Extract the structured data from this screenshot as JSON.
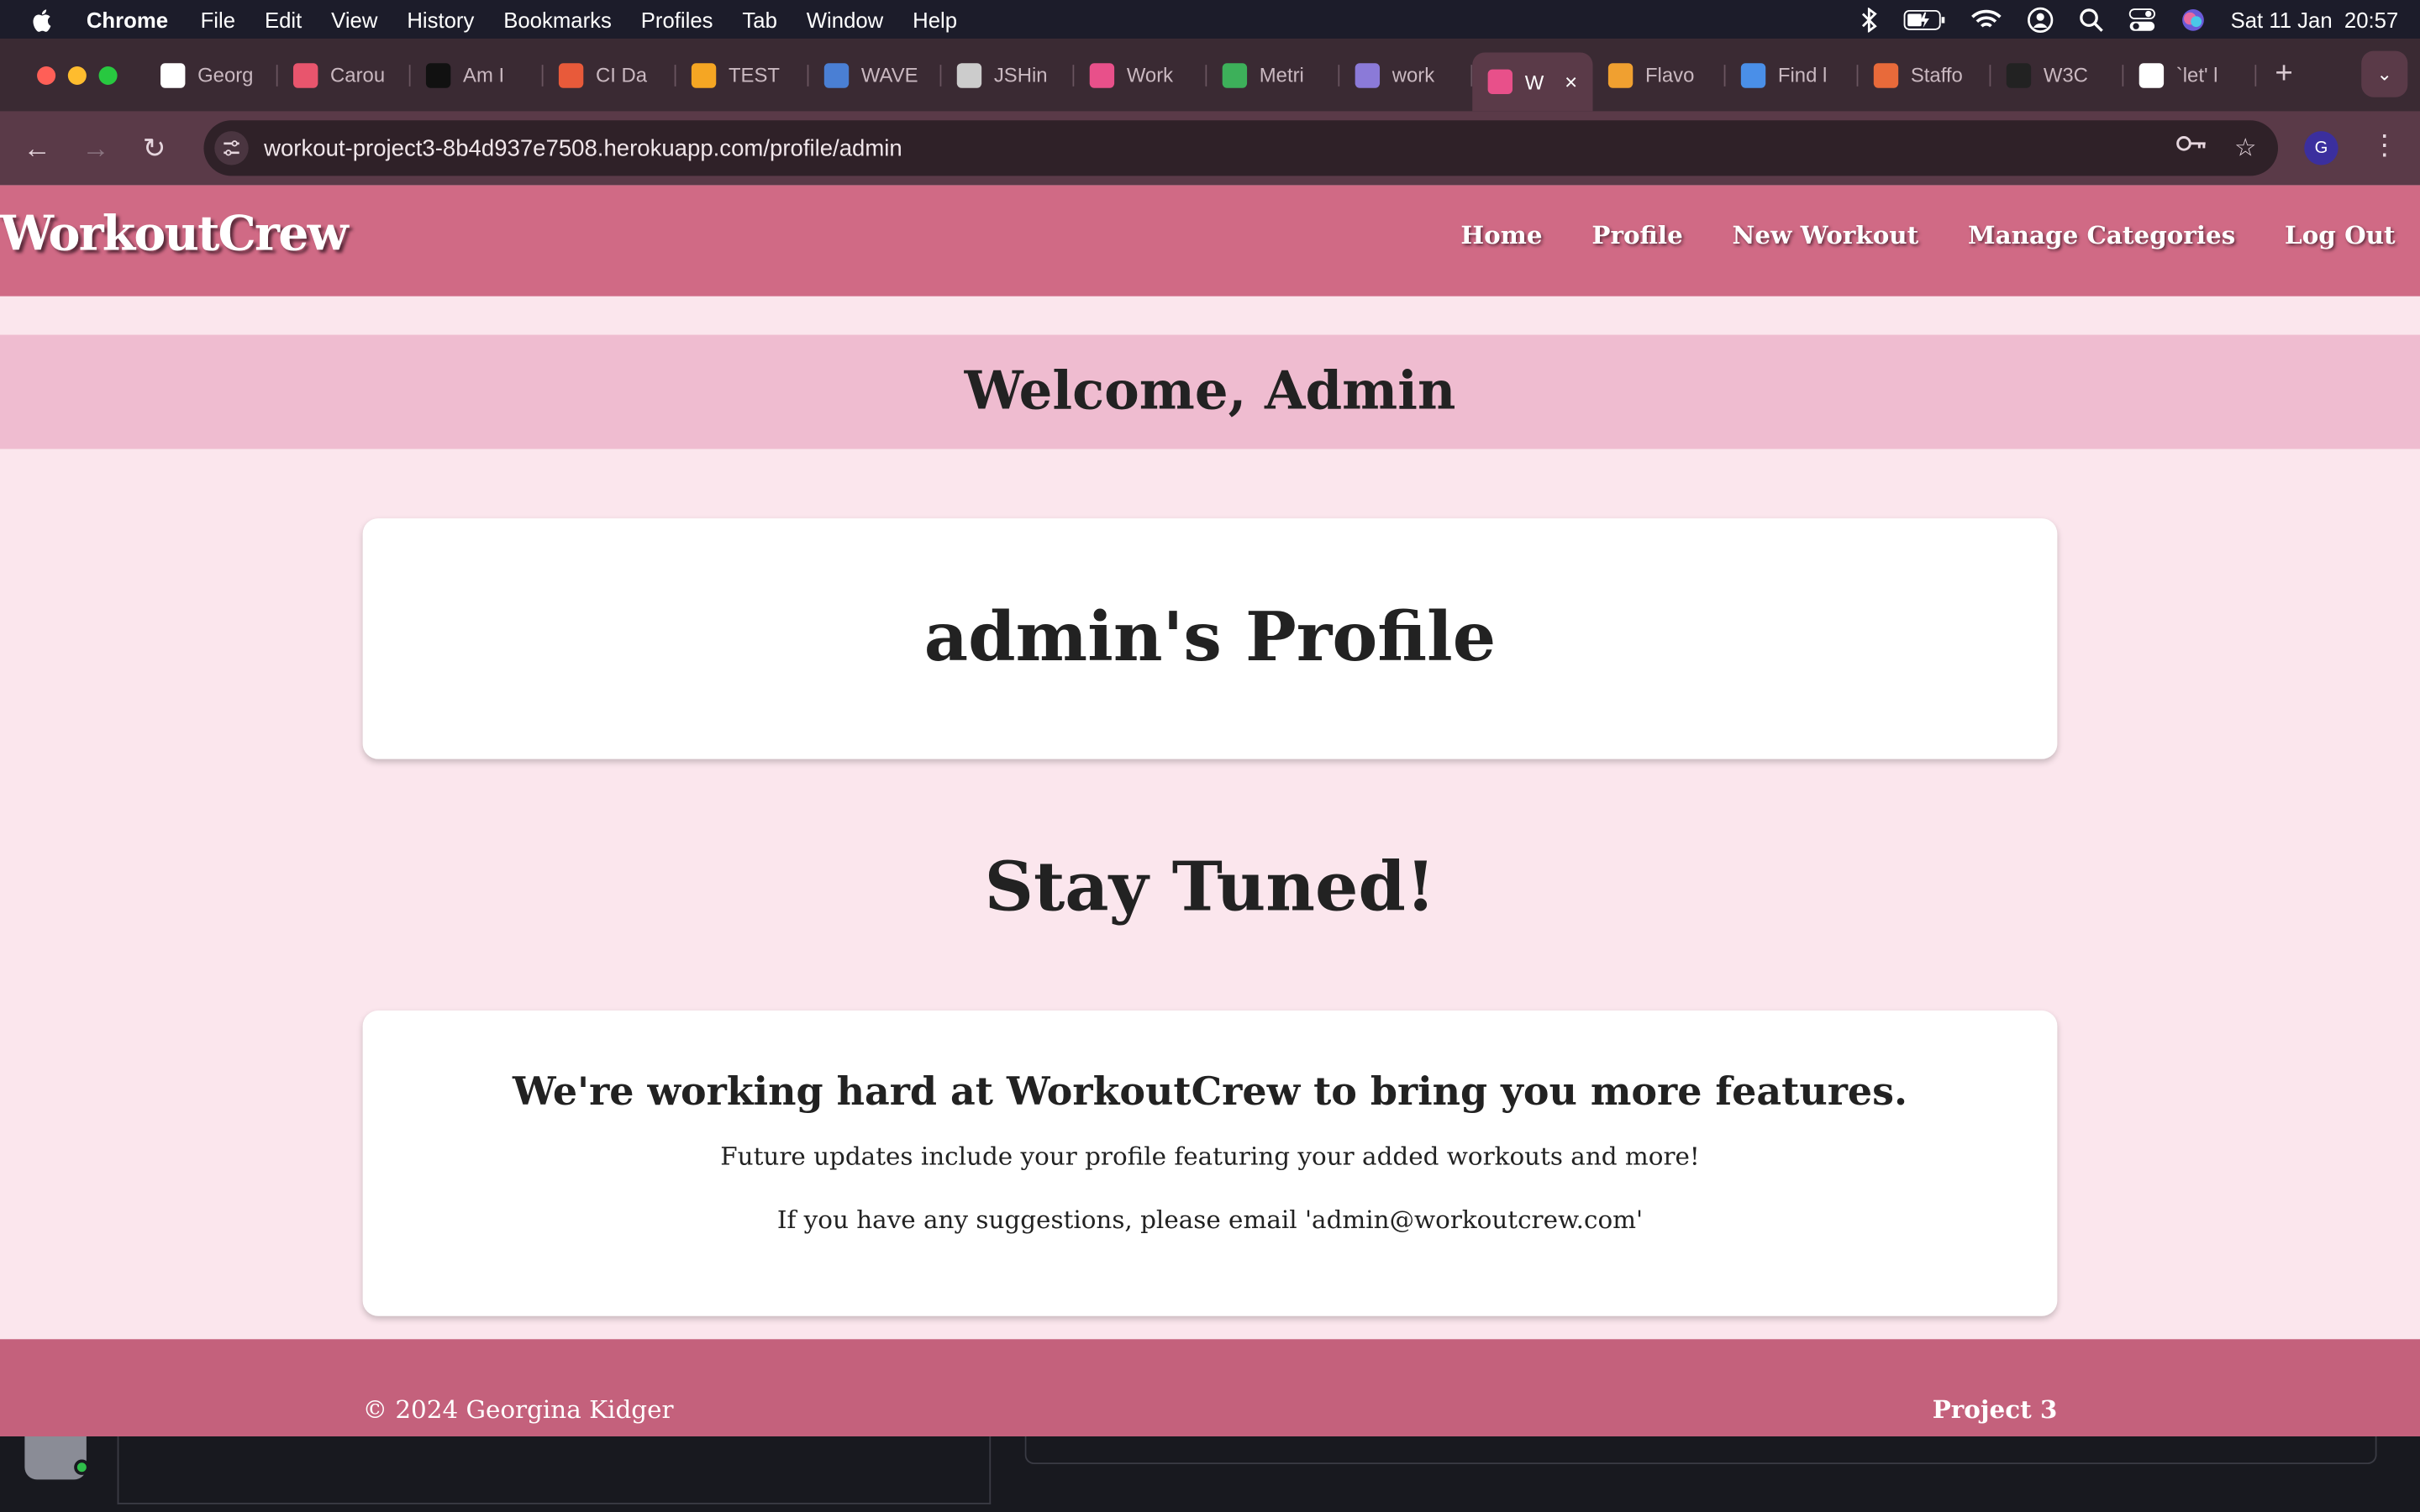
{
  "menubar": {
    "app_name": "Chrome",
    "items": [
      "File",
      "Edit",
      "View",
      "History",
      "Bookmarks",
      "Profiles",
      "Tab",
      "Window",
      "Help"
    ],
    "datetime": "Sat 11 Jan  20:57"
  },
  "tabs": [
    {
      "label": "Georg",
      "color": "#ffffff",
      "icon": "github-icon"
    },
    {
      "label": "Carou",
      "color": "#e8556d",
      "icon": "carousel-icon"
    },
    {
      "label": "Am I",
      "color": "#111111",
      "icon": "ui-icon"
    },
    {
      "label": "CI Da",
      "color": "#e85a3a",
      "icon": "ci-icon"
    },
    {
      "label": "TEST",
      "color": "#f5a623",
      "icon": "test-icon"
    },
    {
      "label": "WAVE",
      "color": "#4a7fd4",
      "icon": "wave-icon"
    },
    {
      "label": "JSHin",
      "color": "#cccccc",
      "icon": "jshint-icon"
    },
    {
      "label": "Work",
      "color": "#e8508a",
      "icon": "dumbbell-icon"
    },
    {
      "label": "Metri",
      "color": "#3db05a",
      "icon": "leaf-icon"
    },
    {
      "label": "work",
      "color": "#8b7ad8",
      "icon": "heroku-icon"
    },
    {
      "label": "W",
      "color": "#e8508a",
      "icon": "dumbbell-icon",
      "active": true
    },
    {
      "label": "Flavo",
      "color": "#f0a030",
      "icon": "fries-icon"
    },
    {
      "label": "Find l",
      "color": "#4a8fe8",
      "icon": "flag-icon"
    },
    {
      "label": "Staffo",
      "color": "#e86a3a",
      "icon": "staff-icon"
    },
    {
      "label": "W3C",
      "color": "#222222",
      "icon": "w3c-icon"
    },
    {
      "label": "`let' l",
      "color": "#ffffff",
      "icon": "github-icon"
    }
  ],
  "address_bar": {
    "url": "workout-project3-8b4d937e7508.herokuapp.com/profile/admin"
  },
  "profile_initial": "G",
  "site": {
    "brand": "WorkoutCrew",
    "nav": [
      "Home",
      "Profile",
      "New Workout",
      "Manage Categories",
      "Log Out"
    ],
    "welcome": "Welcome, Admin",
    "profile_title": "admin's Profile",
    "stay_tuned": "Stay Tuned!",
    "feature_heading": "We're working hard at WorkoutCrew to bring you more features.",
    "feature_text_1": "Future updates include your profile featuring your added workouts and more!",
    "feature_text_2": "If you have any suggestions, please email 'admin@workoutcrew.com'",
    "footer_copy": "© 2024 Georgina Kidger",
    "footer_project": "Project 3",
    "colors": {
      "navbar": "#d06a85",
      "welcome_band": "#efbcd0",
      "page_bg": "#fbe6ed",
      "footer": "#c4617c"
    }
  }
}
